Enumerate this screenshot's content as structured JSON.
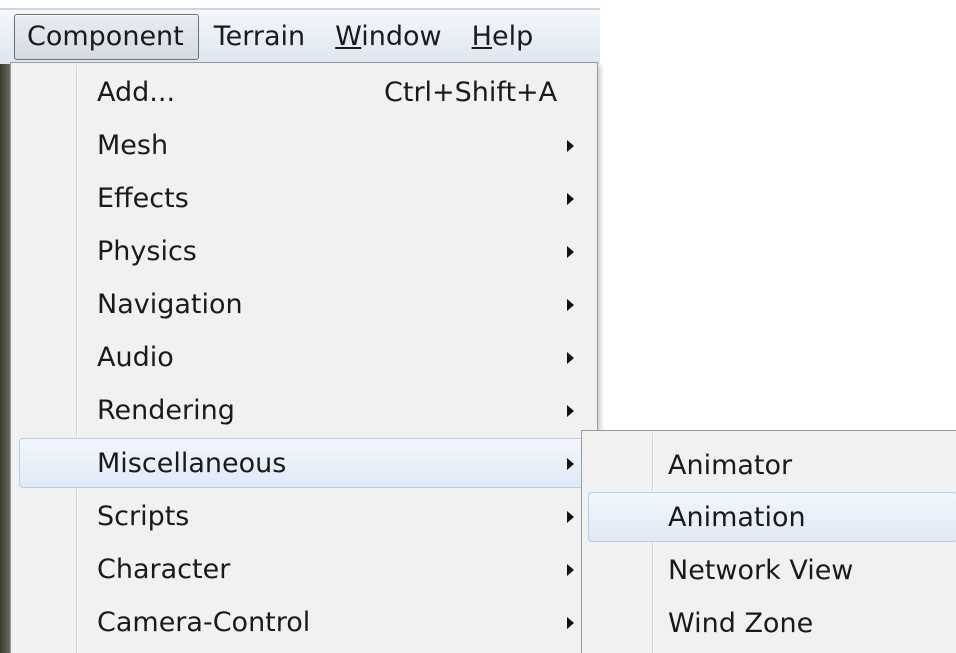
{
  "menubar": {
    "items": [
      {
        "label": "Component",
        "active": true
      },
      {
        "label": "Terrain",
        "active": false
      },
      {
        "label": "Window",
        "mnemonic": "W",
        "active": false
      },
      {
        "label": "Help",
        "mnemonic": "H",
        "active": false
      }
    ]
  },
  "component_menu": {
    "items": [
      {
        "label": "Add...",
        "shortcut": "Ctrl+Shift+A",
        "submenu": false
      },
      {
        "label": "Mesh",
        "submenu": true
      },
      {
        "label": "Effects",
        "submenu": true
      },
      {
        "label": "Physics",
        "submenu": true
      },
      {
        "label": "Navigation",
        "submenu": true
      },
      {
        "label": "Audio",
        "submenu": true
      },
      {
        "label": "Rendering",
        "submenu": true
      },
      {
        "label": "Miscellaneous",
        "submenu": true,
        "highlighted": true
      },
      {
        "label": "Scripts",
        "submenu": true
      },
      {
        "label": "Character",
        "submenu": true
      },
      {
        "label": "Camera-Control",
        "submenu": true
      }
    ]
  },
  "miscellaneous_submenu": {
    "items": [
      {
        "label": "Animator"
      },
      {
        "label": "Animation",
        "highlighted": true
      },
      {
        "label": "Network View"
      },
      {
        "label": "Wind Zone"
      }
    ]
  },
  "colors": {
    "menu_background": "#f1f1f1",
    "highlight_border": "#b9cde6",
    "highlight_fill": "#dfe9f6",
    "menubar_background": "#dde6f1"
  },
  "icons": {
    "submenu_arrow": "chevron-right-icon"
  }
}
